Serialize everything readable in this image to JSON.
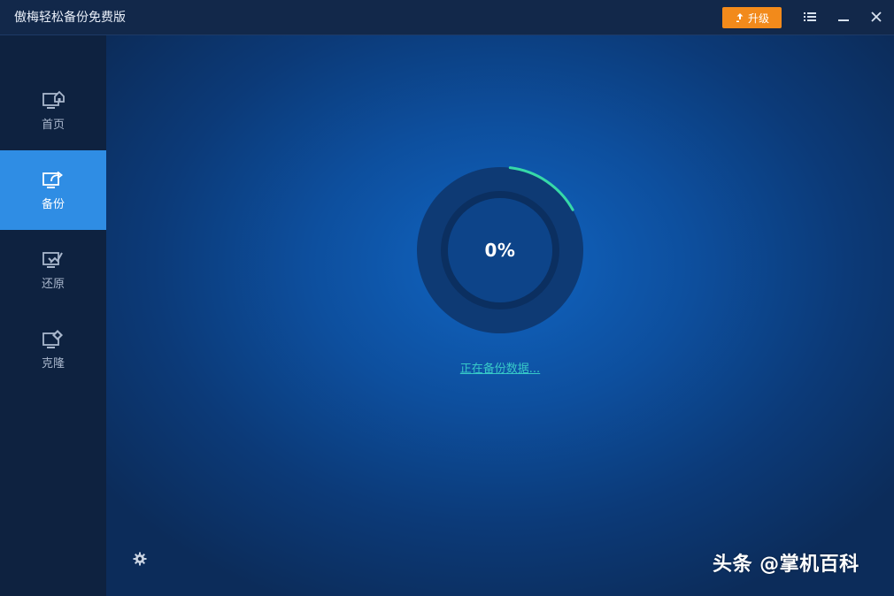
{
  "app": {
    "title": "傲梅轻松备份免费版",
    "upgrade_label": "升级"
  },
  "icons": {
    "upgrade": "upload-arrow-icon",
    "menu": "list-menu-icon",
    "minimize": "minimize-icon",
    "close": "close-icon",
    "settings": "gear-icon"
  },
  "sidebar": {
    "items": [
      {
        "label": "首页",
        "icon": "monitor-home-icon",
        "active": false
      },
      {
        "label": "备份",
        "icon": "monitor-export-icon",
        "active": true
      },
      {
        "label": "还原",
        "icon": "monitor-restore-icon",
        "active": false
      },
      {
        "label": "克隆",
        "icon": "monitor-clone-icon",
        "active": false
      }
    ]
  },
  "progress": {
    "percent_text": "0%",
    "ring_fraction": 0.15,
    "status_text": "正在备份数据..."
  },
  "colors": {
    "accent": "#2f8de4",
    "upgrade": "#f28a1b",
    "progress_ring": "#36d9a8",
    "status_link": "#37c9c8"
  },
  "watermark": {
    "text": "头条 @掌机百科"
  }
}
